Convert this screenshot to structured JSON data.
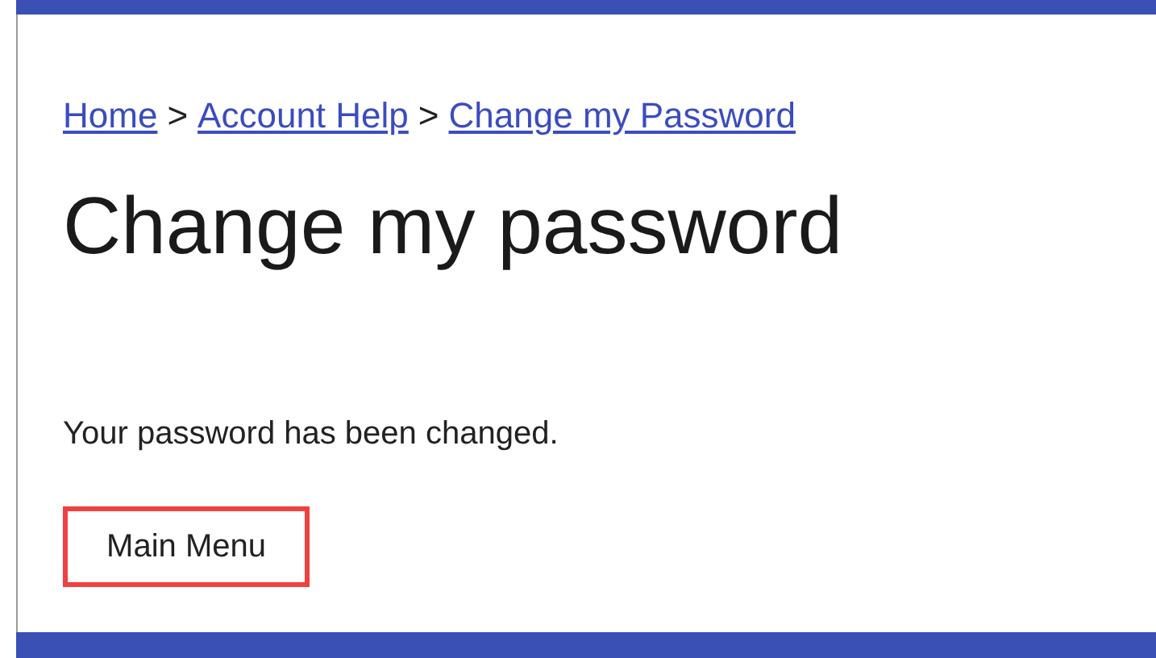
{
  "breadcrumb": [
    {
      "label": "Home"
    },
    {
      "label": "Account Help"
    },
    {
      "label": "Change my Password"
    }
  ],
  "separator": ">",
  "heading": "Change my password",
  "message": "Your password has been changed.",
  "button": {
    "label": "Main Menu",
    "highlighted": true
  }
}
